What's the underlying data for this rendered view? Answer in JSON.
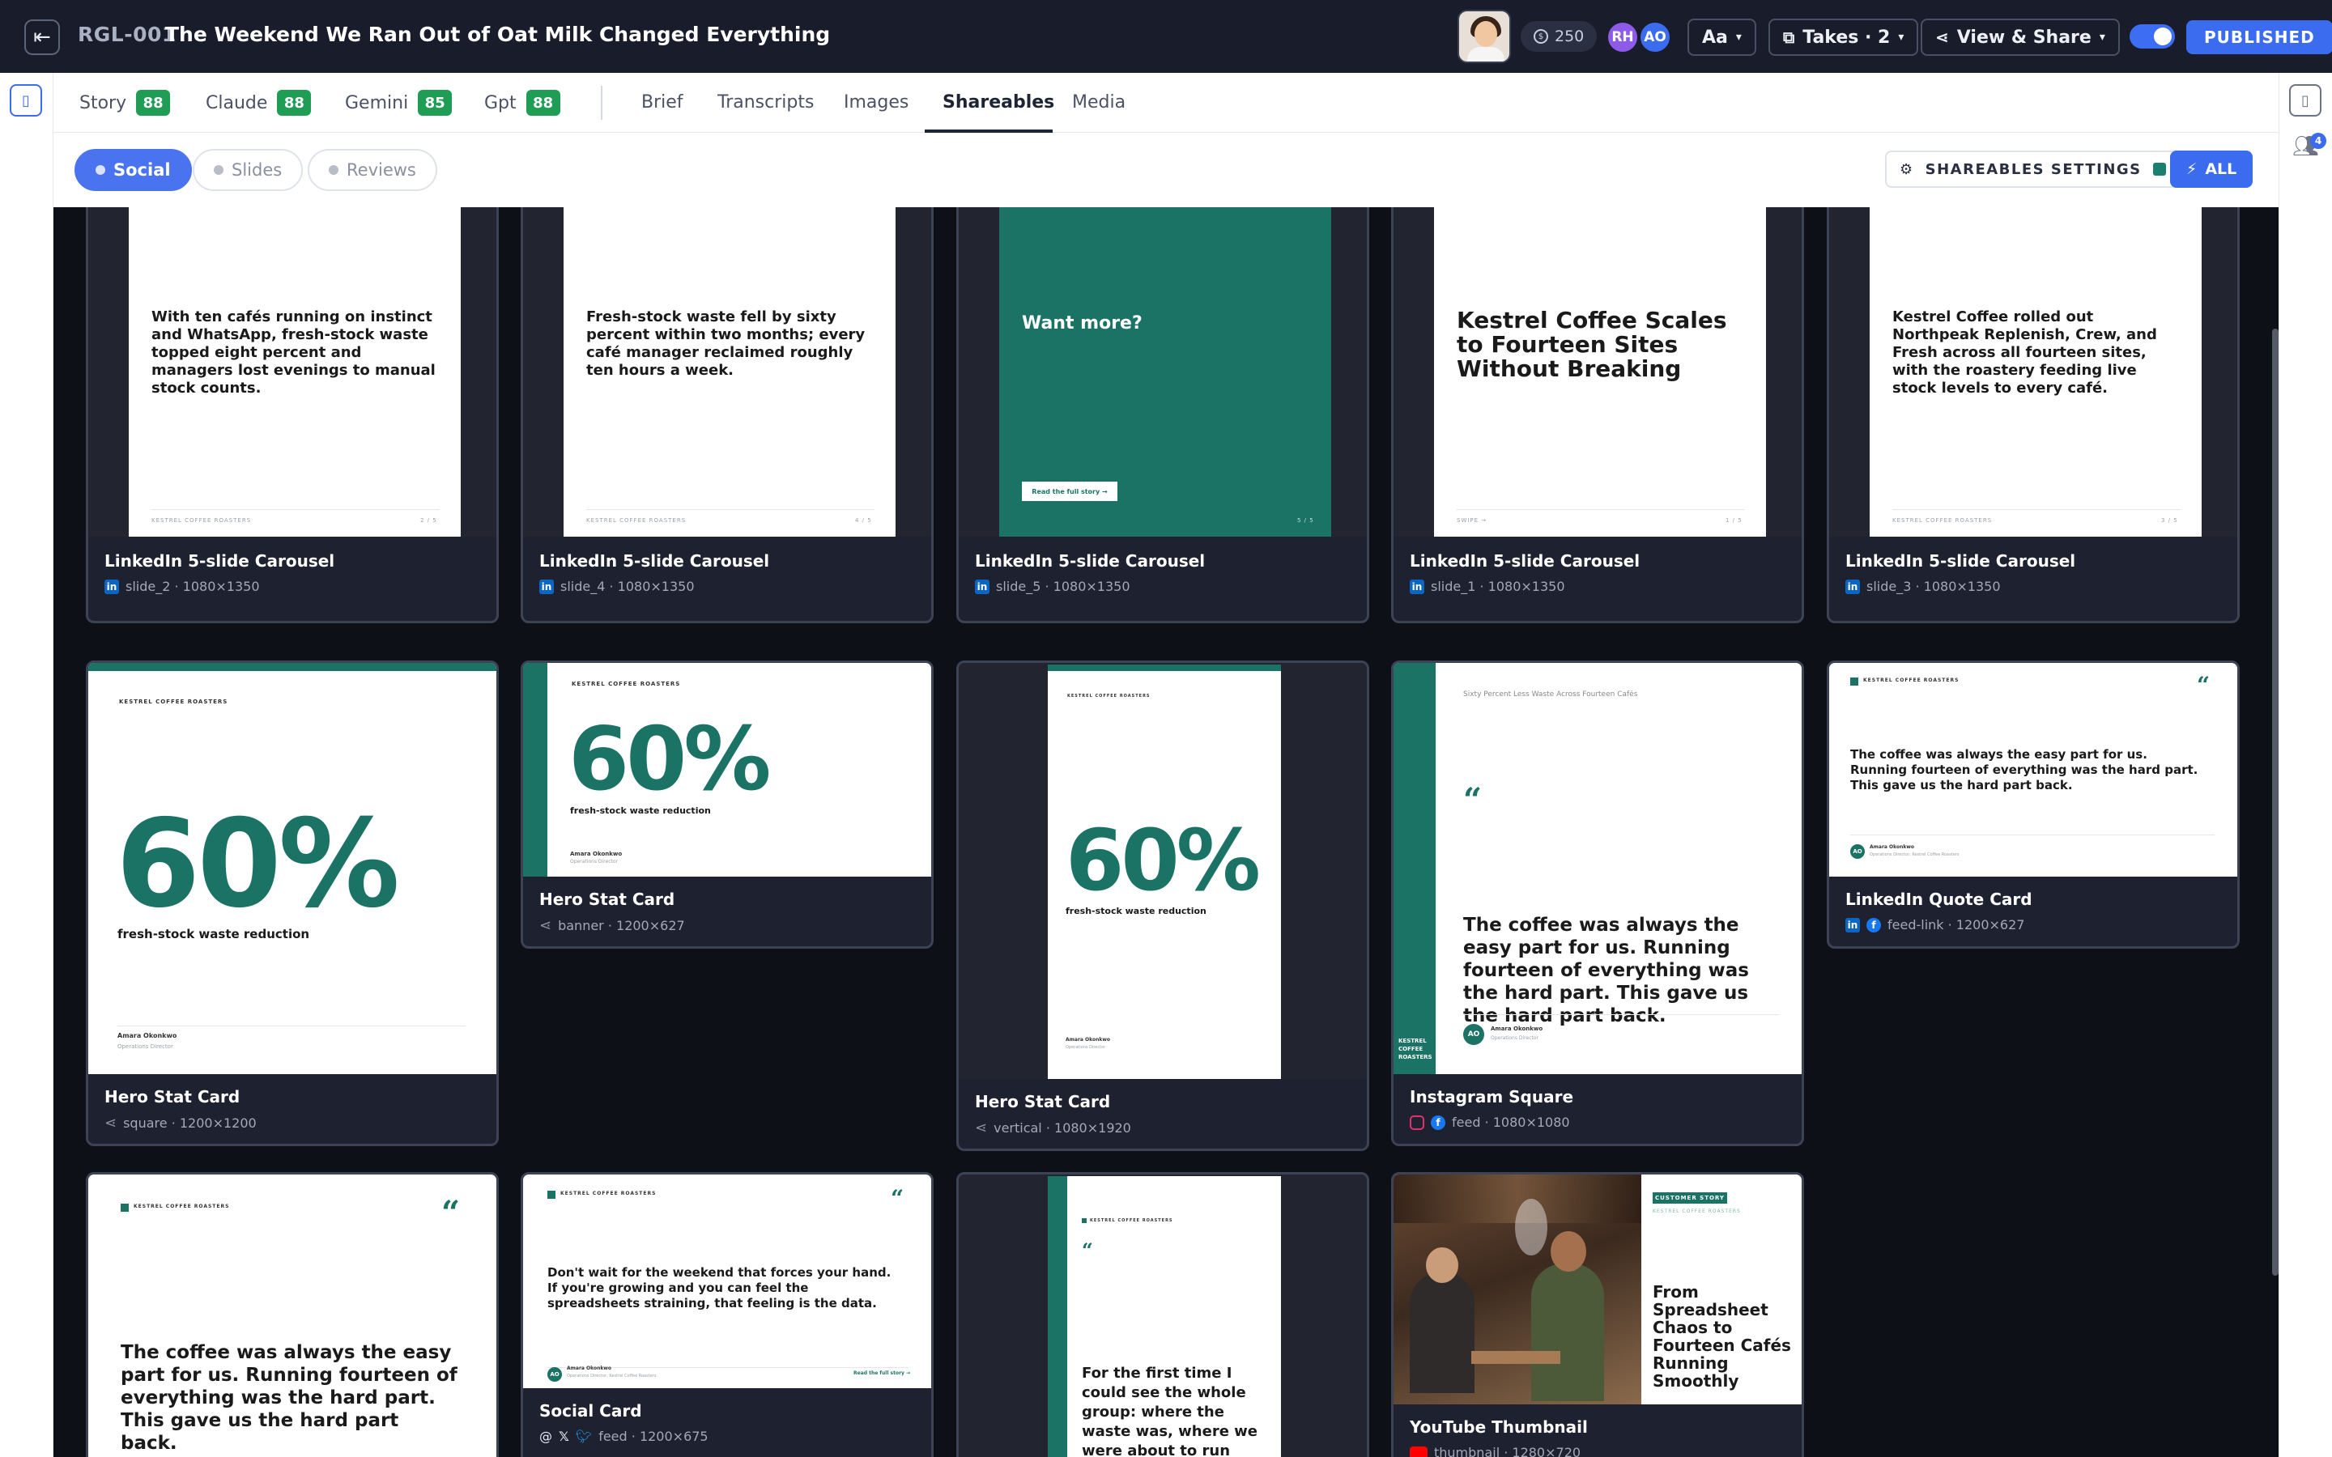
{
  "header": {
    "story_id": "RGL-001",
    "title": "The Weekend We Ran Out of Oat Milk Changed Everything",
    "credits": "250",
    "users": [
      "RH",
      "AO"
    ],
    "font_label": "Aa",
    "takes_label": "Takes · 2",
    "view_share_label": "View & Share",
    "published_label": "PUBLISHED"
  },
  "model_tabs": [
    {
      "label": "Story",
      "score": "88"
    },
    {
      "label": "Claude",
      "score": "88"
    },
    {
      "label": "Gemini",
      "score": "85"
    },
    {
      "label": "Gpt",
      "score": "88"
    }
  ],
  "nav_tabs": [
    "Brief",
    "Transcripts",
    "Images",
    "Shareables",
    "Media"
  ],
  "active_tab": "Shareables",
  "filters": [
    "Social",
    "Slides",
    "Reviews"
  ],
  "settings_label": "SHAREABLES SETTINGS",
  "all_label": "ALL",
  "notifications": "4",
  "colors": {
    "brand_teal": "#1b7365",
    "accent_blue": "#3b6cf0",
    "score_green": "#1f9d55"
  },
  "slides": {
    "slide2_text": "With ten cafés running on instinct and WhatsApp, fresh-stock waste topped eight percent and managers lost evenings to manual stock counts.",
    "slide2_page": "2 / 5",
    "slide4_text": "Fresh-stock waste fell by sixty percent within two months; every café manager reclaimed roughly ten hours a week.",
    "slide4_page": "4 / 5",
    "slide5_text": "Want more?",
    "slide5_cta": "Read the full story →",
    "slide5_page": "5 / 5",
    "slide1_text": "Kestrel Coffee Scales to Fourteen Sites Without Breaking",
    "slide1_swipe": "Swipe →",
    "slide1_page": "1 / 5",
    "slide3_text": "Kestrel Coffee rolled out Northpeak Replenish, Crew, and Fresh across all fourteen sites, with the roastery feeding live stock levels to every café.",
    "slide3_page": "3 / 5",
    "brand": "KESTREL COFFEE ROASTERS"
  },
  "stat": {
    "value": "60%",
    "label": "fresh-stock waste reduction",
    "person": "Amara Okonkwo",
    "role": "Operations Director",
    "role_full": "Operations Director, Kestrel Coffee Roasters"
  },
  "quote": {
    "text": "The coffee was always the easy part for us. Running fourteen of everything was the hard part. This gave us the hard part back.",
    "headline": "Sixty Percent Less Waste Across Fourteen Cafés",
    "initials": "AO",
    "brand_vertical": "KESTREL COFFEE ROASTERS"
  },
  "social": {
    "text": "Don't wait for the weekend that forces your hand. If you're growing and you can feel the spreadsheets straining, that feeling is the data.",
    "link": "Read the full story →"
  },
  "vertical_quote": {
    "text": "For the first time I could see the whole group: where the waste was, where we were about to run short"
  },
  "youtube": {
    "badge": "CUSTOMER STORY",
    "brand": "KESTREL COFFEE ROASTERS",
    "title": "From Spreadsheet Chaos to Fourteen Cafés Running Smoothly"
  },
  "cards": [
    {
      "title": "LinkedIn 5-slide Carousel",
      "meta": "slide_2 · 1080×1350"
    },
    {
      "title": "LinkedIn 5-slide Carousel",
      "meta": "slide_4 · 1080×1350"
    },
    {
      "title": "LinkedIn 5-slide Carousel",
      "meta": "slide_5 · 1080×1350"
    },
    {
      "title": "LinkedIn 5-slide Carousel",
      "meta": "slide_1 · 1080×1350"
    },
    {
      "title": "LinkedIn 5-slide Carousel",
      "meta": "slide_3 · 1080×1350"
    },
    {
      "title": "Hero Stat Card",
      "meta": "square · 1200×1200"
    },
    {
      "title": "Hero Stat Card",
      "meta": "banner · 1200×627"
    },
    {
      "title": "Hero Stat Card",
      "meta": "vertical · 1080×1920"
    },
    {
      "title": "Instagram Square",
      "meta": "feed · 1080×1080"
    },
    {
      "title": "LinkedIn Quote Card",
      "meta": "feed-link · 1200×627"
    },
    {
      "title": "Social Card",
      "meta": "feed · 1200×675"
    },
    {
      "title": "YouTube Thumbnail",
      "meta": "thumbnail · 1280×720"
    }
  ]
}
